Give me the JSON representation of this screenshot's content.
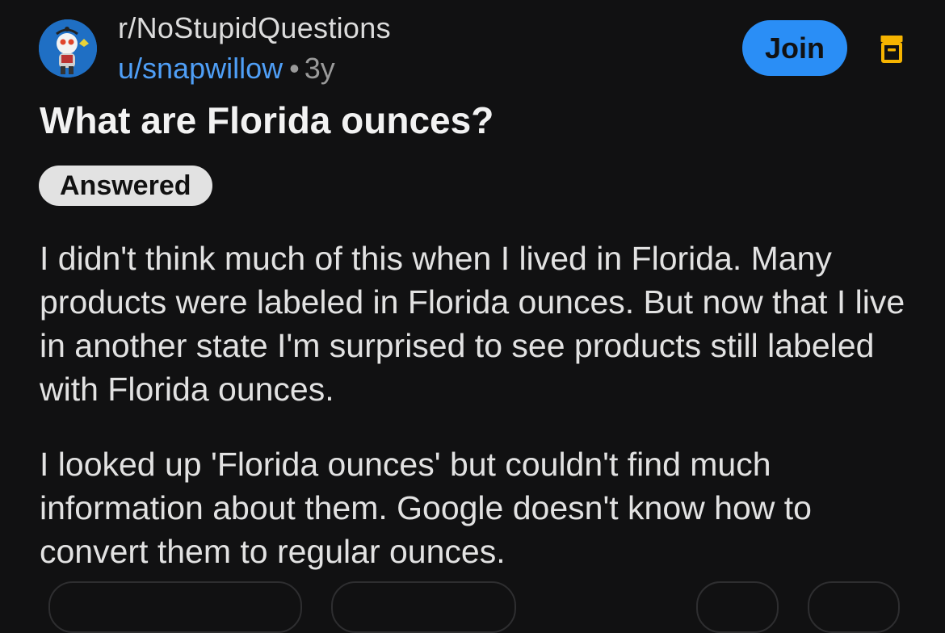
{
  "post": {
    "subreddit": "r/NoStupidQuestions",
    "author": "u/snapwillow",
    "age": "3y",
    "title": "What are Florida ounces?",
    "flair": "Answered",
    "body": [
      "I didn't think much of this when I lived in Florida. Many products were labeled in Florida ounces. But now that I live in another state I'm surprised to see products still labeled with Florida ounces.",
      "I looked up 'Florida ounces' but couldn't find much information about them. Google doesn't know how to convert them to regular ounces."
    ]
  },
  "actions": {
    "join_label": "Join"
  },
  "icons": {
    "avatar": "subreddit-snoo-avatar",
    "archive": "archive-box-icon"
  },
  "colors": {
    "background": "#111112",
    "accent_blue": "#2a8ef6",
    "username_blue": "#4f9ff7",
    "archive_orange": "#f6b400"
  }
}
